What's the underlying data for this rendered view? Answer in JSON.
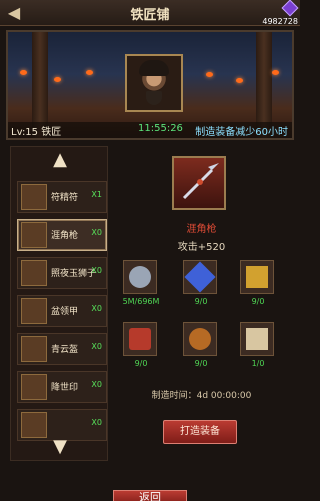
{
  "header": {
    "title": "铁匠铺",
    "currency_value": "4982728"
  },
  "banner": {
    "level_text": "Lv:15 铁匠",
    "timer": "11:55:26",
    "reduce_text": "制造装备减少60小时"
  },
  "left_list": {
    "items": [
      {
        "name": "符精符",
        "count": "X1"
      },
      {
        "name": "涯角枪",
        "count": "X0"
      },
      {
        "name": "照夜玉狮子",
        "count": "X0"
      },
      {
        "name": "盆领甲",
        "count": "X0"
      },
      {
        "name": "青云盔",
        "count": "X0"
      },
      {
        "name": "降世印",
        "count": "X0"
      },
      {
        "name": "",
        "count": "X0"
      }
    ]
  },
  "detail": {
    "name": "涯角枪",
    "stat": "攻击+520",
    "materials": [
      {
        "label": "5M/696M",
        "color": "#9aa5b5"
      },
      {
        "label": "9/0",
        "color": "#3f61d8"
      },
      {
        "label": "9/0",
        "color": "#d2a12f"
      },
      {
        "label": "9/0",
        "color": "#b63a2b"
      },
      {
        "label": "9/0",
        "color": "#b66a24"
      },
      {
        "label": "1/0",
        "color": "#d8c6a1"
      }
    ],
    "make_time": "制造时间：4d 00:00:00",
    "make_button": "打造装备"
  },
  "footer": {
    "back_button": "返回"
  }
}
